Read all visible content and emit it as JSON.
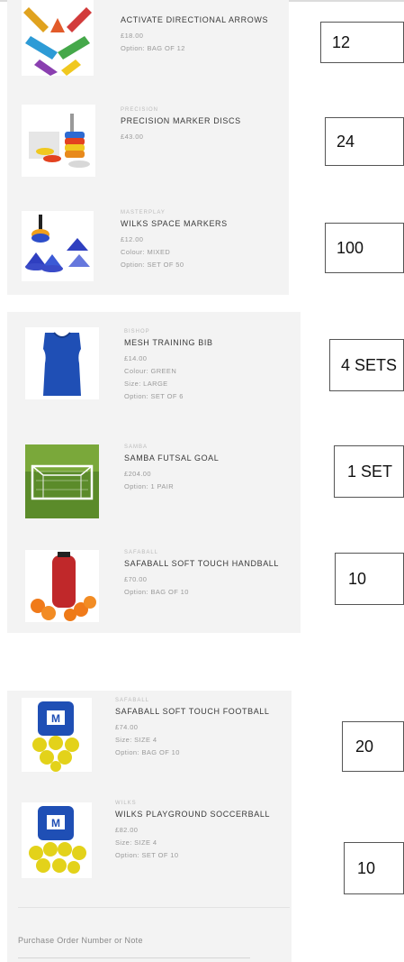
{
  "cart": {
    "items": [
      {
        "brand": "",
        "name": "ACTIVATE DIRECTIONAL ARROWS",
        "price": "£18.00",
        "details": [
          "Option: BAG OF 12"
        ],
        "image_icon": "directional-arrows-image",
        "quantity_note": "12"
      },
      {
        "brand": "PRECISION",
        "name": "PRECISION MARKER DISCS",
        "price": "£43.00",
        "details": [],
        "image_icon": "marker-discs-image",
        "quantity_note": "24"
      },
      {
        "brand": "MASTERPLAY",
        "name": "WILKS SPACE MARKERS",
        "price": "£12.00",
        "details": [
          "Colour: MIXED",
          "Option: SET OF 50"
        ],
        "image_icon": "space-markers-image",
        "quantity_note": "100"
      },
      {
        "brand": "BISHOP",
        "name": "MESH TRAINING BIB",
        "price": "£14.00",
        "details": [
          "Colour: GREEN",
          "Size: LARGE",
          "Option: SET OF 6"
        ],
        "image_icon": "training-bib-image",
        "quantity_note": "4 SETS"
      },
      {
        "brand": "SAMBA",
        "name": "SAMBA FUTSAL GOAL",
        "price": "£204.00",
        "details": [
          "Option: 1 PAIR"
        ],
        "image_icon": "futsal-goal-image",
        "quantity_note": "1 SET"
      },
      {
        "brand": "SAFABALL",
        "name": "SAFABALL SOFT TOUCH HANDBALL",
        "price": "£70.00",
        "details": [
          "Option: BAG OF 10"
        ],
        "image_icon": "handball-bag-image",
        "quantity_note": "10"
      },
      {
        "brand": "SAFABALL",
        "name": "SAFABALL SOFT TOUCH FOOTBALL",
        "price": "£74.00",
        "details": [
          "Size: SIZE 4",
          "Option: BAG OF 10"
        ],
        "image_icon": "football-bag-image",
        "quantity_note": "20"
      },
      {
        "brand": "WILKS",
        "name": "WILKS PLAYGROUND SOCCERBALL",
        "price": "£82.00",
        "details": [
          "Size: SIZE 4",
          "Option: SET OF 10"
        ],
        "image_icon": "soccerball-bag-image",
        "quantity_note": "10"
      }
    ],
    "po_label": "Purchase Order Number or Note"
  },
  "colors": {
    "panel_bg": "#f3f3f3",
    "bib_blue": "#1f4fb5",
    "handball_red": "#c0282a",
    "ball_yellow": "#e3d21a"
  }
}
